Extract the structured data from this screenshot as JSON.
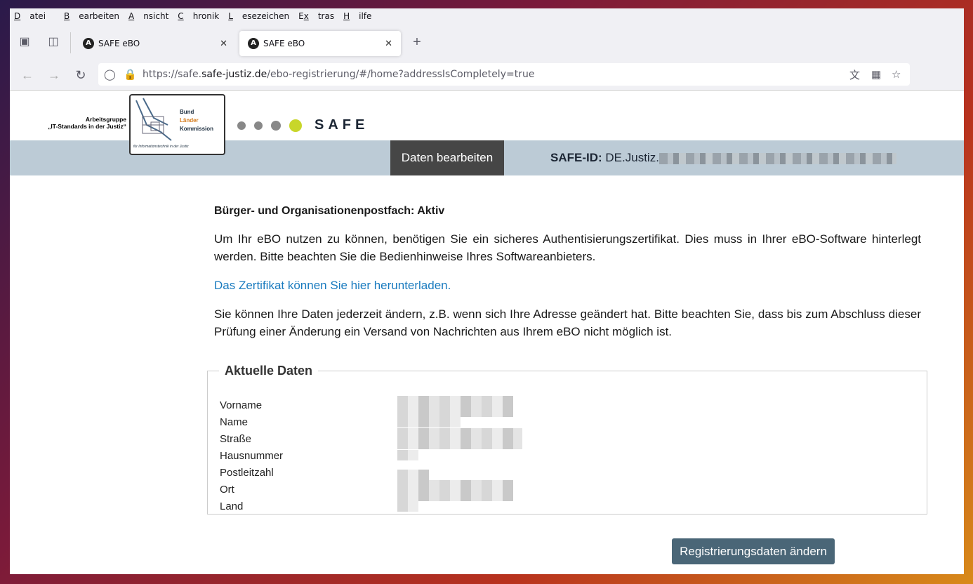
{
  "menubar": [
    "Datei",
    "Bearbeiten",
    "Ansicht",
    "Chronik",
    "Lesezeichen",
    "Extras",
    "Hilfe"
  ],
  "menubar_underline": [
    "D",
    "B",
    "A",
    "C",
    "L",
    "x",
    "H"
  ],
  "tabs": [
    {
      "title": "SAFE eBO",
      "active": false
    },
    {
      "title": "SAFE eBO",
      "active": true
    }
  ],
  "url": {
    "prefix": "https://safe.",
    "host": "safe-justiz.de",
    "path": "/ebo-registrierung/#/home?addressIsCompletely=true"
  },
  "header": {
    "ag_line1": "Arbeitsgruppe",
    "ag_line2": "„IT-Standards in der Justiz“",
    "logo_line1": "Bund",
    "logo_line2": "Länder",
    "logo_line3": "Kommission",
    "logo_sub": "für Informationstechnik in der Justiz",
    "safe_label": "SAFE",
    "nav_button": "Daten bearbeiten",
    "safe_id_label": "SAFE-ID:",
    "safe_id_value": "DE.Justiz."
  },
  "content": {
    "heading": "Bürger- und Organisationenpostfach: Aktiv",
    "para1": "Um Ihr eBO nutzen zu können, benötigen Sie ein sicheres Authentisierungszertifikat. Dies muss in Ihrer eBO-Software hinterlegt werden. Bitte beachten Sie die Bedienhinweise Ihres Softwareanbieters.",
    "link": "Das Zertifikat können Sie hier herunterladen.",
    "para2": "Sie können Ihre Daten jederzeit ändern, z.B. wenn sich Ihre Adresse geändert hat. Bitte beachten Sie, dass bis zum Abschluss dieser Prüfung einer Änderung ein Versand von Nachrichten aus Ihrem eBO nicht möglich ist."
  },
  "fieldset": {
    "legend": "Aktuelle Daten",
    "fields": [
      "Vorname",
      "Name",
      "Straße",
      "Hausnummer",
      "Postleitzahl",
      "Ort",
      "Land"
    ]
  },
  "button": "Registrierungsdaten ändern"
}
